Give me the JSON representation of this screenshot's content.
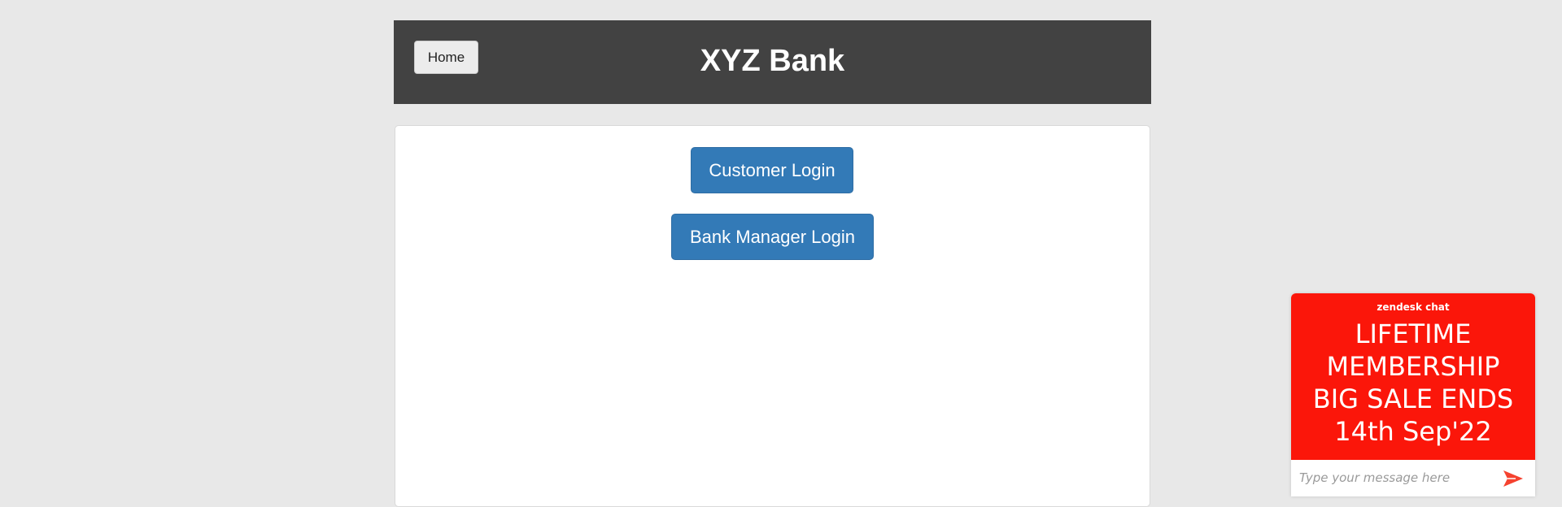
{
  "header": {
    "home_label": "Home",
    "title": "XYZ Bank"
  },
  "main": {
    "customer_login_label": "Customer Login",
    "manager_login_label": "Bank Manager Login"
  },
  "chat": {
    "brand": "zendesk chat",
    "promo_lines": [
      "LIFETIME",
      "MEMBERSHIP",
      "BIG SALE ENDS",
      "14th Sep'22"
    ],
    "input_placeholder": "Type your message here",
    "send_icon": "send-arrow-icon",
    "accent_color": "#fb160a"
  },
  "colors": {
    "page_bg": "#e8e8e8",
    "header_bg": "#424242",
    "primary_button": "#337ab7"
  }
}
